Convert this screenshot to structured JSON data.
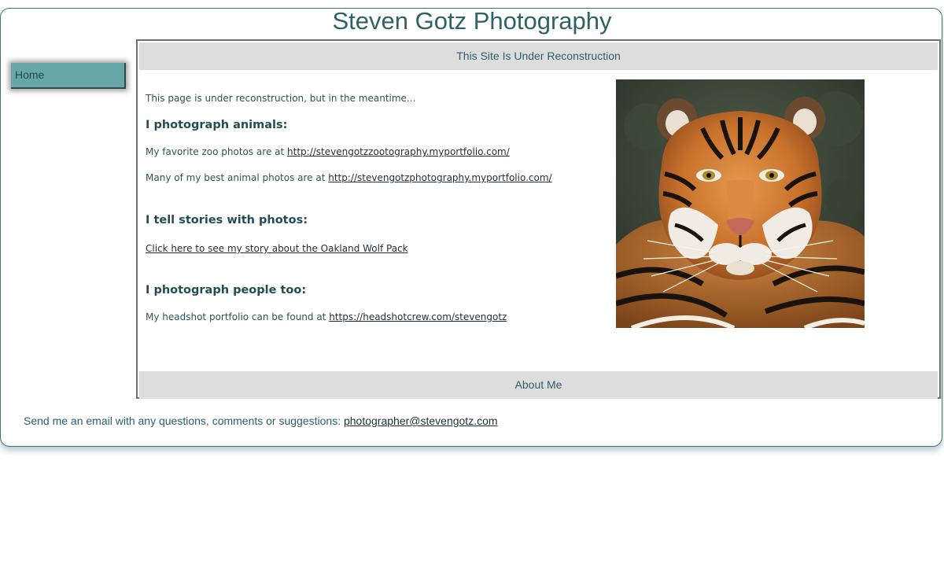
{
  "site": {
    "title": "Steven Gotz Photography"
  },
  "nav": {
    "items": [
      {
        "label": "Home"
      }
    ]
  },
  "main": {
    "banner": "This Site Is Under Reconstruction",
    "intro": "This page is under reconstruction, but in the meantime...",
    "sections": [
      {
        "heading": "I photograph animals:",
        "lines": [
          {
            "text": "My favorite zoo photos are at ",
            "link": "http://stevengotzzootography.myportfolio.com/"
          },
          {
            "text": "Many of my best animal photos are at ",
            "link": "http://stevengotzphotography.myportfolio.com/"
          }
        ]
      },
      {
        "heading": "I tell stories with photos:",
        "lines": [
          {
            "text": "",
            "link": "Click here to see my story about the Oakland Wolf Pack"
          }
        ]
      },
      {
        "heading": "I photograph people too:",
        "lines": [
          {
            "text": "My headshot portfolio can be found at ",
            "link": "https://headshotcrew.com/stevengotz"
          }
        ]
      }
    ],
    "footer_bar": "About Me"
  },
  "footer": {
    "text": "Send me an email with any questions, comments or suggestions: ",
    "email": "photographer@stevengotz.com"
  },
  "colors": {
    "accent": "#2e6266",
    "nav_button": "#67a7a7",
    "bar_bg": "#dddddd"
  }
}
